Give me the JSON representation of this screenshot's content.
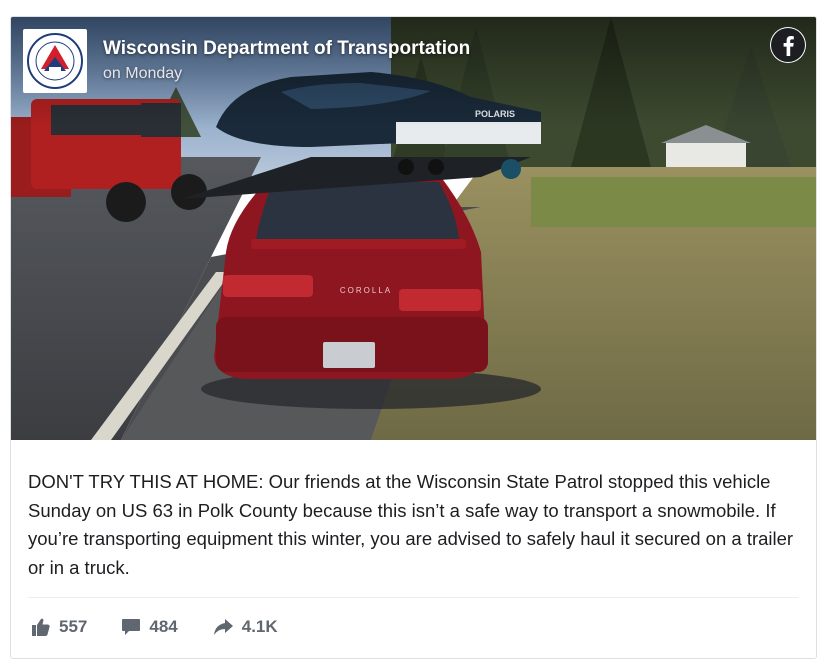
{
  "post": {
    "page_name": "Wisconsin Department of Transportation",
    "time": "on Monday",
    "text": "DON'T TRY THIS AT HOME: Our friends at the Wisconsin State Patrol stopped this vehicle Sunday on US 63 in Polk County because this isn’t a safe way to transport a snowmobile. If you’re transporting equipment this winter, you are advised to safely haul it secured on a trailer or in a truck."
  },
  "stats": {
    "likes": "557",
    "comments": "484",
    "shares": "4.1K"
  },
  "logo": {
    "seal_text_top": "WISCONSIN",
    "seal_text_bottom": "DEPARTMENT OF TRANSPORTATION"
  },
  "photo": {
    "car_make_badge": "COROLLA",
    "snowmobile_brand": "POLARIS"
  },
  "colors": {
    "brand_red": "#c8102e",
    "facebook_black": "#1c1e21",
    "text": "#1c1e21",
    "muted": "#606770"
  },
  "icons": {
    "like": "thumbs-up-icon",
    "comment": "comment-bubble-icon",
    "share": "share-arrow-icon",
    "facebook": "facebook-logo-icon"
  }
}
